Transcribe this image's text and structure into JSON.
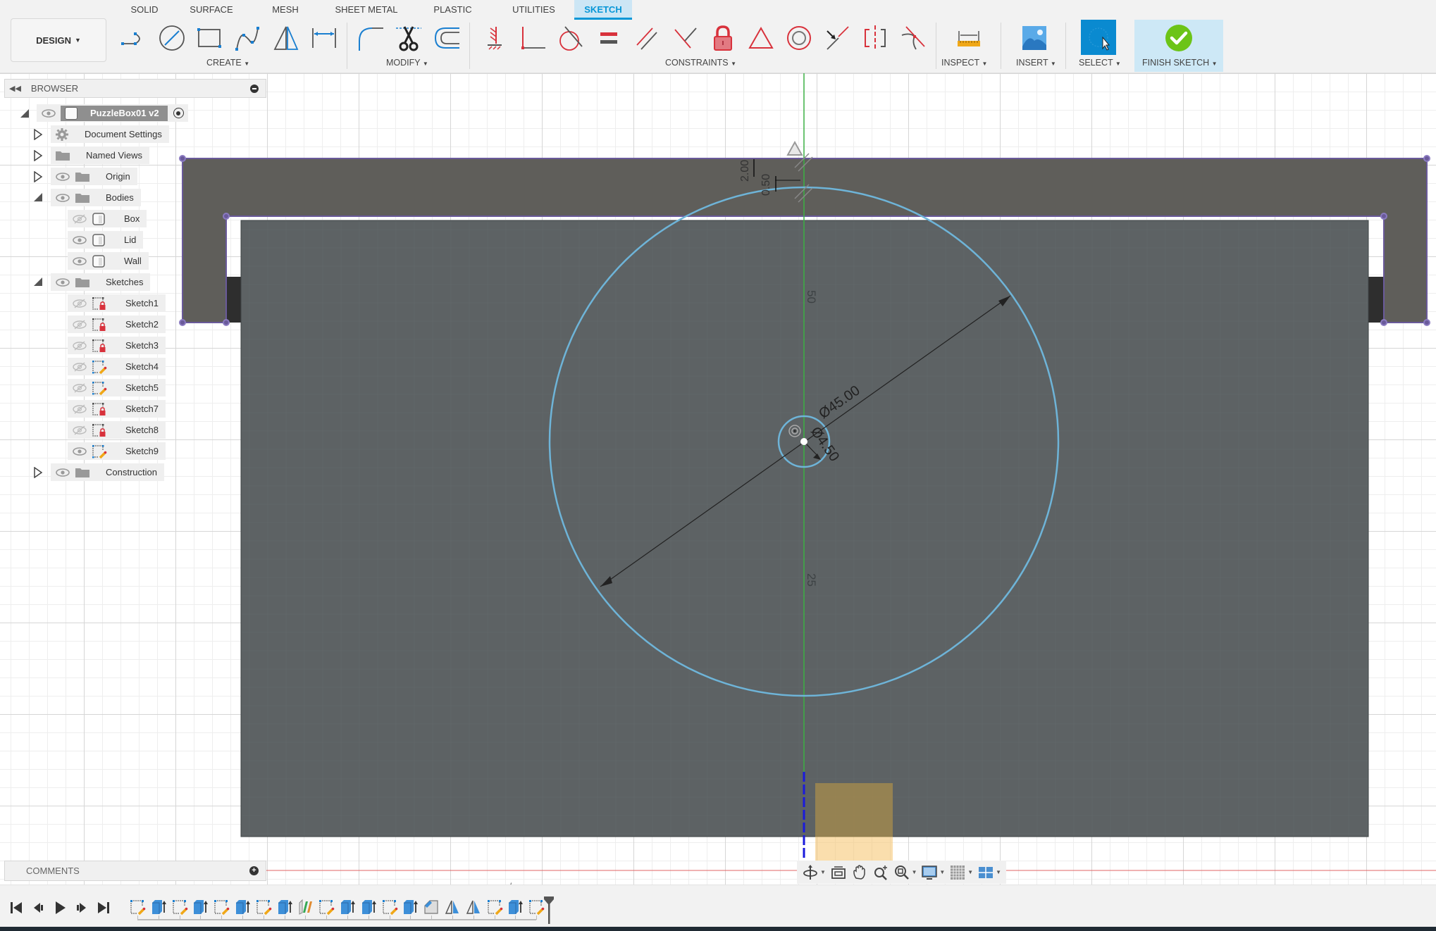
{
  "toolbar": {
    "workspace_button": "DESIGN",
    "tabs": [
      {
        "label": "SOLID",
        "active": false
      },
      {
        "label": "SURFACE",
        "active": false
      },
      {
        "label": "MESH",
        "active": false
      },
      {
        "label": "SHEET METAL",
        "active": false
      },
      {
        "label": "PLASTIC",
        "active": false
      },
      {
        "label": "UTILITIES",
        "active": false
      },
      {
        "label": "SKETCH",
        "active": true
      }
    ],
    "groups": {
      "create": {
        "label": "CREATE",
        "tools": [
          "line-icon",
          "circle-icon",
          "rectangle-icon",
          "spline-icon",
          "mirror-icon",
          "dimension-icon"
        ]
      },
      "modify": {
        "label": "MODIFY",
        "tools": [
          "fillet-icon",
          "trim-icon",
          "offset-icon"
        ]
      },
      "constraints": {
        "label": "CONSTRAINTS",
        "tools": [
          "horizontal-vertical-icon",
          "coincident-icon",
          "tangent-icon",
          "equal-icon",
          "parallel-icon",
          "perpendicular-icon",
          "fix-lock-icon",
          "midpoint-icon",
          "concentric-icon",
          "collinear-icon",
          "symmetry-icon",
          "curvature-icon"
        ]
      },
      "inspect": {
        "label": "INSPECT"
      },
      "insert": {
        "label": "INSERT"
      },
      "select": {
        "label": "SELECT"
      },
      "finish": {
        "label": "FINISH SKETCH"
      }
    },
    "colors": {
      "accent": "#0696d7",
      "finish_green": "#6cc417",
      "constraint_red": "#d8323c",
      "tab_active_bg": "#cce6f5"
    }
  },
  "browser": {
    "title": "BROWSER",
    "root": "PuzzleBox01 v2",
    "items": [
      {
        "label": "Document Settings",
        "icon": "gear-icon",
        "expander": "collapsed"
      },
      {
        "label": "Named Views",
        "icon": "folder-icon",
        "expander": "collapsed"
      },
      {
        "label": "Origin",
        "icon": "folder-icon",
        "expander": "collapsed",
        "visible": true
      },
      {
        "label": "Bodies",
        "icon": "folder-icon",
        "expander": "expanded",
        "visible": true
      },
      {
        "label": "Box",
        "icon": "body-icon",
        "visible": false,
        "child": true
      },
      {
        "label": "Lid",
        "icon": "body-icon",
        "visible": true,
        "child": true
      },
      {
        "label": "Wall",
        "icon": "body-icon",
        "visible": true,
        "child": true
      },
      {
        "label": "Sketches",
        "icon": "folder-icon",
        "expander": "expanded",
        "visible": true
      },
      {
        "label": "Sketch1",
        "icon": "sketch-locked-icon",
        "visible": false,
        "child": true
      },
      {
        "label": "Sketch2",
        "icon": "sketch-locked-icon",
        "visible": false,
        "child": true
      },
      {
        "label": "Sketch3",
        "icon": "sketch-locked-icon",
        "visible": false,
        "child": true
      },
      {
        "label": "Sketch4",
        "icon": "sketch-edit-icon",
        "visible": false,
        "child": true
      },
      {
        "label": "Sketch5",
        "icon": "sketch-edit-icon",
        "visible": false,
        "child": true
      },
      {
        "label": "Sketch7",
        "icon": "sketch-locked-icon",
        "visible": false,
        "child": true
      },
      {
        "label": "Sketch8",
        "icon": "sketch-locked-icon",
        "visible": false,
        "child": true
      },
      {
        "label": "Sketch9",
        "icon": "sketch-edit-icon",
        "visible": true,
        "child": true
      },
      {
        "label": "Construction",
        "icon": "folder-icon",
        "expander": "collapsed",
        "visible": true
      }
    ]
  },
  "sketch": {
    "dimensions": {
      "large_diameter": "Ø45.00",
      "small_diameter": "Ø4.50",
      "top_offset_a": "2.00",
      "top_offset_b": "0.50",
      "axis_label_upper": "50",
      "axis_label_lower": "25"
    },
    "colors": {
      "wall": "#5f5e5a",
      "face": "#5d6264",
      "sketch_curve": "#6eb4d8",
      "profile_edge": "#6a5a9a",
      "axis_green": "#3cb043",
      "axis_blue": "#1a1adc",
      "highlight": "#f5c36a"
    }
  },
  "comments": {
    "title": "COMMENTS"
  },
  "navbar": {
    "tools": [
      "orbit-icon",
      "look-at-icon",
      "pan-icon",
      "zoom-icon",
      "fit-icon",
      "display-settings-icon",
      "grid-icon",
      "viewports-icon"
    ]
  },
  "timeline": {
    "controls": [
      "first-icon",
      "previous-icon",
      "play-icon",
      "next-icon",
      "last-icon"
    ],
    "features": [
      "sketch",
      "extrude",
      "sketch",
      "extrude",
      "sketch",
      "extrude",
      "sketch",
      "extrude",
      "split",
      "sketch",
      "extrude",
      "extrude",
      "sketch",
      "extrude",
      "chamfer",
      "mirror",
      "mirror",
      "sketch",
      "extrude",
      "sketch"
    ]
  }
}
